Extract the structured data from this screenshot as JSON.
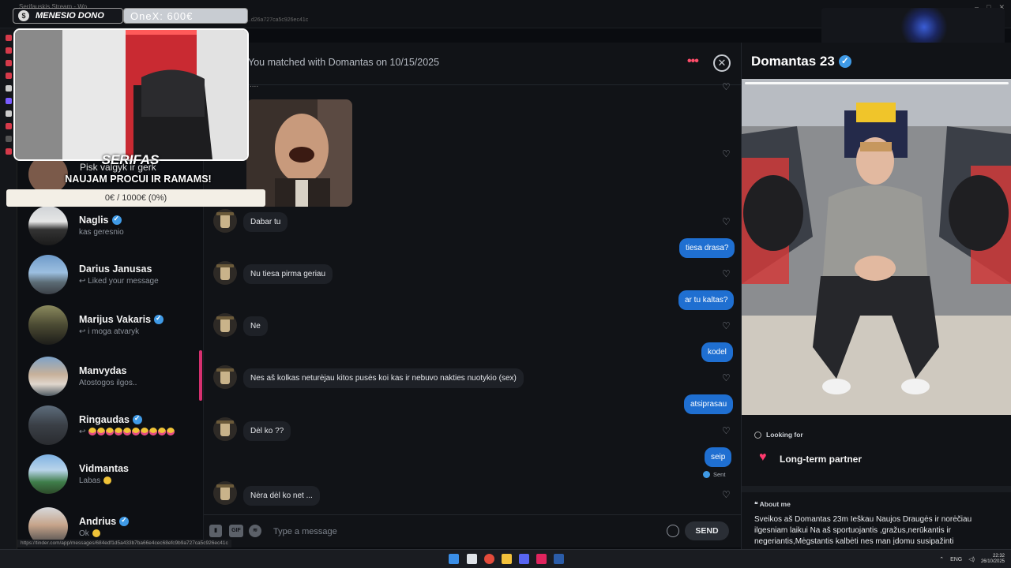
{
  "browser": {
    "tab_title": "Serifauskis Stream - Wo...",
    "url_fragment": "...d26a727ca5c926ec41c",
    "status_url": "https://tinder.com/app/messages/684edf1d5a433b7ba66e4cec68efc9b9a727ca5c926ec41c"
  },
  "overlays": {
    "donor": "MENESIO DONO",
    "onex": "OneX: 600€",
    "webcam_caption": "SERIFAS",
    "behind_text": "Pisk valgyk ir gerk",
    "goal_title": "NAUJAM PROCUI IR RAMAMS!",
    "goal_progress": "0€ / 1000€ (0%)",
    "goal_fraction": 0
  },
  "sidebar": {
    "items": [
      {
        "name": "Naglis",
        "preview": "kas geresnio",
        "verified": true
      },
      {
        "name": "Darius Janusas",
        "preview": "↩ Liked your message",
        "verified": false
      },
      {
        "name": "Marijus Vakaris",
        "preview": "↩ i moga atvaryk",
        "verified": true
      },
      {
        "name": "Manvydas",
        "preview": "Atostogos ilgos..",
        "verified": false
      },
      {
        "name": "Ringaudas",
        "preview": "↩",
        "verified": true
      },
      {
        "name": "Vidmantas",
        "preview": "Labas",
        "verified": false
      },
      {
        "name": "Andrius",
        "preview": "Ok",
        "verified": true
      }
    ]
  },
  "chat": {
    "match_text": "You matched with Domantas on 10/15/2025",
    "more_icon": "more-dots-icon",
    "close_icon": "close-icon",
    "top_ellipsis": "....",
    "messages": [
      {
        "dir": "in",
        "text": "Dabar  tu"
      },
      {
        "dir": "out",
        "text": "tiesa drasa?"
      },
      {
        "dir": "in",
        "text": "Nu tiesa pirma geriau"
      },
      {
        "dir": "out",
        "text": "ar tu kaltas?"
      },
      {
        "dir": "in",
        "text": "Ne"
      },
      {
        "dir": "out",
        "text": "kodel"
      },
      {
        "dir": "in",
        "text": "Nes aš kolkas neturėjau kitos pusės koi kas ir nebuvo nakties nuotykio (sex)"
      },
      {
        "dir": "out",
        "text": "atsiprasau"
      },
      {
        "dir": "in",
        "text": "Dėl ko ??"
      },
      {
        "dir": "out",
        "text": "seip"
      },
      {
        "dir": "in",
        "text": "Nėra dėl ko net ..."
      }
    ],
    "sent_label": "Sent",
    "composer_placeholder": "Type a message",
    "send_label": "SEND",
    "gif_label": "GIF"
  },
  "profile": {
    "name": "Domantas 23",
    "looking_for_label": "Looking for",
    "looking_for_value": "Long-term partner",
    "about_label": "About me",
    "about_text": "Sveikos aš Domantas 23m Ieškau Naujos Draugės ir norėčiau ilgesniam laikui Na aš sportuojantis ,gražus,nerūkantis ir negeriantis,Mėgstantis kalbėti nes man įdomu susipažinti"
  },
  "taskbar": {
    "lang": "ENG",
    "time": "22:32",
    "date": "26/10/2025"
  },
  "colors": {
    "accent": "#ff4d6a",
    "outgoing_bubble": "#1f6fd1",
    "incoming_bubble": "#1e2127",
    "verified": "#3f9ae6"
  }
}
